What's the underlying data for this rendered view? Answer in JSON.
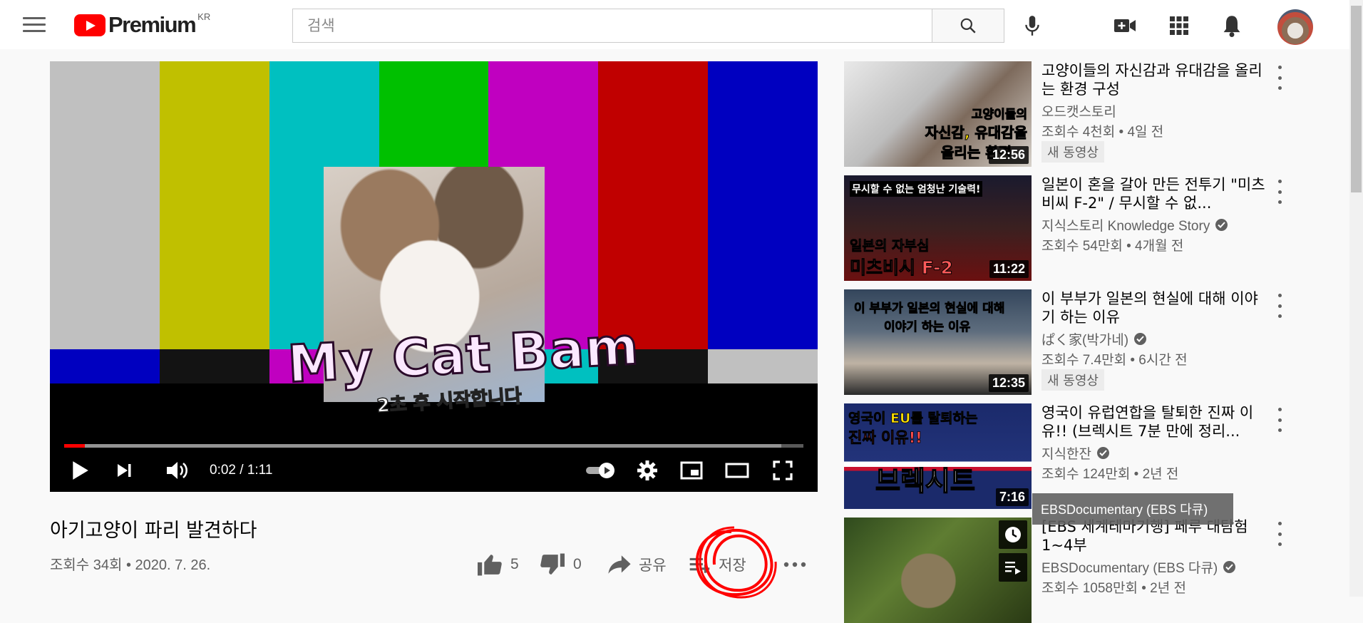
{
  "masthead": {
    "logo_text": "Premium",
    "logo_region": "KR",
    "search": {
      "placeholder": "검색",
      "value": ""
    },
    "icons": [
      "menu-icon",
      "search-icon",
      "mic-icon",
      "create-video-icon",
      "apps-icon",
      "notifications-icon"
    ]
  },
  "player": {
    "overlay_title": "My Cat Bam",
    "overlay_subtitle": "2초 후 시작합니다",
    "time": "0:02 / 1:11",
    "progress_fraction": 0.028,
    "loaded_fraction": 0.97,
    "bar_colors_top": [
      "#c0c0c0",
      "#c0c000",
      "#00c0c0",
      "#00c000",
      "#c000c0",
      "#c00000",
      "#0000c0"
    ],
    "bar_colors_mid": [
      "#0000c0",
      "#131313",
      "#c000c0",
      "#131313",
      "#00c0c0",
      "#131313",
      "#c0c0c0"
    ],
    "bar_colors_bottom": [
      "#00214c",
      "#ffffff",
      "#32006a",
      "#131313",
      "#090909",
      "#1d1d1d",
      "#131313"
    ]
  },
  "video": {
    "title": "아기고양이 파리 발견하다",
    "meta": "조회수 34회 • 2020. 7. 26.",
    "likes": "5",
    "dislikes": "0",
    "share_label": "공유",
    "save_label": "저장"
  },
  "sidebar": {
    "tooltip": "EBSDocumentary (EBS 다큐)",
    "items": [
      {
        "title": "고양이들의 자신감과 유대감을 올리는 환경 구성",
        "channel": "오드캣스토리",
        "verified": false,
        "views": "조회수 4천회 • 4일 전",
        "badge": "새 동영상",
        "duration": "12:56",
        "thumb_text": [
          "고양이들의",
          "자신감, 유대감을",
          "올리는 환경"
        ]
      },
      {
        "title": "일본이 혼을 갈아 만든 전투기 \"미츠비씨 F-2\" / 무시할 수 없...",
        "channel": "지식스토리 Knowledge Story",
        "verified": true,
        "views": "조회수 54만회 • 4개월 전",
        "badge": "",
        "duration": "11:22",
        "thumb_text": [
          "무시할 수 없는 엄청난 기술력!",
          "일본의 자부심",
          "미츠비시 F-2"
        ]
      },
      {
        "title": "이 부부가 일본의 현실에 대해 이야기 하는 이유",
        "channel": "ぱく家(박가네)",
        "verified": true,
        "views": "조회수 7.4만회 • 6시간 전",
        "badge": "새 동영상",
        "duration": "12:35",
        "thumb_text": [
          "이 부부가 일본의 현실에 대해",
          "이야기 하는 이유"
        ]
      },
      {
        "title": "영국이 유럽연합을 탈퇴한 진짜 이유!! (브렉시트 7분 만에 정리...",
        "channel": "지식한잔",
        "verified": true,
        "views": "조회수 124만회 • 2년 전",
        "badge": "",
        "duration": "7:16",
        "thumb_text": [
          "영국이 EU를 탈퇴하는",
          "진짜 이유!!",
          "브렉시트"
        ]
      },
      {
        "title": "[EBS 세계테마기행] 페루 대탐험 1~4부",
        "channel": "EBSDocumentary (EBS 다큐)",
        "verified": true,
        "views": "조회수 1058만회 • 2년 전",
        "badge": "",
        "duration": "",
        "thumb_text": []
      }
    ]
  }
}
